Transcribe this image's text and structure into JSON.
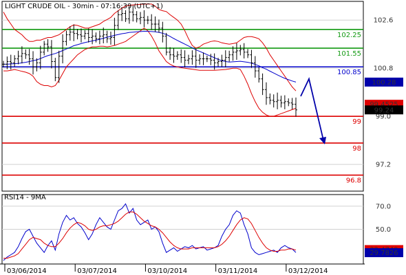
{
  "chart_data": [
    {
      "type": "candlestick",
      "title": "LIGHT CRUDE OIL - 30min - 07:16:39 (UTC+1)",
      "ylim": [
        96.2,
        103.3
      ],
      "y_ticks": [
        "102.6",
        "100.8",
        "99.0",
        "97.2"
      ],
      "x_ticks": [
        "03/06/2014",
        "03/07/2014",
        "03/10/2014",
        "03/11/2014",
        "03/12/2014"
      ],
      "levels": [
        {
          "label": "102.25",
          "value": 102.25,
          "color": "#119911"
        },
        {
          "label": "101.55",
          "value": 101.55,
          "color": "#119911"
        },
        {
          "label": "100.85",
          "value": 100.85,
          "color": "#0000cc"
        },
        {
          "label": "99",
          "value": 99.0,
          "color": "#dd0000"
        },
        {
          "label": "98",
          "value": 98.0,
          "color": "#dd0000"
        },
        {
          "label": "96.8",
          "value": 96.8,
          "color": "#dd0000"
        }
      ],
      "markers": [
        {
          "label": "100.28",
          "value": 100.28,
          "style": "blue-box"
        },
        {
          "label": "99.4525",
          "value": 99.45,
          "style": "red-box"
        },
        {
          "label": "99.24",
          "value": 99.24,
          "style": "black-box"
        }
      ],
      "price_series": [
        100.95,
        101.05,
        101.0,
        101.15,
        101.25,
        101.35,
        101.3,
        101.15,
        100.85,
        101.0,
        101.4,
        101.7,
        101.6,
        101.05,
        100.45,
        101.25,
        101.8,
        102.05,
        102.15,
        102.1,
        102.05,
        102.0,
        102.1,
        101.95,
        102.0,
        101.9,
        102.0,
        102.05,
        101.9,
        101.95,
        102.4,
        102.8,
        102.85,
        102.65,
        102.9,
        102.8,
        102.65,
        102.7,
        102.6,
        102.6,
        102.45,
        102.45,
        102.3,
        102.0,
        101.4,
        101.3,
        101.25,
        101.3,
        101.2,
        101.1,
        101.15,
        101.25,
        101.1,
        101.15,
        101.15,
        101.15,
        101.1,
        101.0,
        101.05,
        101.1,
        101.2,
        101.3,
        101.4,
        101.45,
        101.5,
        101.4,
        101.3,
        101.0,
        100.7,
        100.4,
        100.0,
        99.7,
        99.6,
        99.55,
        99.6,
        99.5,
        99.55,
        99.5,
        99.45,
        99.24
      ],
      "series": [
        {
          "name": "",
          "role": "moving-average",
          "color": "#0000cc",
          "values": [
            100.95,
            100.95,
            100.96,
            100.97,
            100.98,
            101.0,
            101.02,
            101.05,
            101.08,
            101.11,
            101.16,
            101.22,
            101.27,
            101.31,
            101.35,
            101.4,
            101.46,
            101.52,
            101.58,
            101.64,
            101.68,
            101.72,
            101.76,
            101.79,
            101.82,
            101.85,
            101.88,
            101.92,
            101.96,
            101.99,
            102.03,
            102.06,
            102.09,
            102.11,
            102.14,
            102.15,
            102.16,
            102.17,
            102.18,
            102.18,
            102.17,
            102.16,
            102.14,
            102.11,
            102.06,
            101.99,
            101.91,
            101.84,
            101.77,
            101.7,
            101.63,
            101.56,
            101.49,
            101.43,
            101.37,
            101.31,
            101.25,
            101.19,
            101.13,
            101.08,
            101.05,
            101.03,
            101.04,
            101.05,
            101.06,
            101.04,
            101.02,
            100.99,
            100.94,
            100.89,
            100.82,
            100.76,
            100.69,
            100.62,
            100.55,
            100.48,
            100.42,
            100.37,
            100.32,
            100.28
          ]
        },
        {
          "name": "",
          "role": "bollinger-upper",
          "color": "#dd0000",
          "values": [
            102.9,
            102.65,
            102.45,
            102.25,
            102.15,
            102.05,
            101.9,
            101.8,
            101.8,
            101.85,
            101.85,
            101.9,
            101.95,
            101.95,
            102.0,
            102.05,
            102.15,
            102.25,
            102.35,
            102.42,
            102.4,
            102.35,
            102.3,
            102.3,
            102.35,
            102.4,
            102.45,
            102.55,
            102.62,
            102.7,
            102.85,
            102.95,
            103.05,
            103.12,
            103.15,
            103.17,
            103.18,
            103.19,
            103.2,
            103.2,
            103.2,
            103.12,
            103.0,
            102.95,
            102.92,
            102.8,
            102.7,
            102.6,
            102.45,
            102.2,
            101.9,
            101.65,
            101.55,
            101.6,
            101.7,
            101.75,
            101.8,
            101.82,
            101.8,
            101.75,
            101.72,
            101.7,
            101.72,
            101.75,
            101.85,
            101.95,
            101.98,
            101.98,
            101.95,
            101.9,
            101.75,
            101.55,
            101.3,
            101.1,
            100.9,
            100.7,
            100.5,
            100.3,
            100.1,
            99.95
          ]
        },
        {
          "name": "",
          "role": "bollinger-lower",
          "color": "#dd0000",
          "values": [
            100.7,
            100.7,
            100.72,
            100.75,
            100.72,
            100.68,
            100.65,
            100.6,
            100.5,
            100.3,
            100.2,
            100.15,
            100.15,
            100.1,
            100.15,
            100.35,
            100.6,
            100.85,
            101.0,
            101.15,
            101.3,
            101.4,
            101.5,
            101.55,
            101.6,
            101.6,
            101.62,
            101.62,
            101.6,
            101.62,
            101.65,
            101.7,
            101.75,
            101.8,
            101.9,
            102.0,
            102.1,
            102.2,
            102.3,
            102.2,
            102.0,
            101.75,
            101.45,
            101.25,
            101.05,
            100.95,
            100.88,
            100.85,
            100.82,
            100.8,
            100.78,
            100.76,
            100.74,
            100.72,
            100.72,
            100.72,
            100.72,
            100.72,
            100.73,
            100.74,
            100.75,
            100.77,
            100.8,
            100.8,
            100.75,
            100.5,
            100.2,
            99.85,
            99.55,
            99.3,
            99.15,
            99.05,
            99.0,
            99.0,
            99.05,
            99.1,
            99.15,
            99.2,
            99.25,
            99.3
          ]
        }
      ],
      "forecast_arrow": {
        "from": 99.75,
        "via": 99.5,
        "to": 98.0
      }
    },
    {
      "type": "line",
      "title": "RSI14 - 9MA",
      "ylim": [
        20,
        80
      ],
      "y_ticks": [
        "70.0",
        "50.0"
      ],
      "markers": [
        {
          "label": "32.4749",
          "value": 32.47,
          "style": "red-box"
        },
        {
          "label": "29.7826",
          "value": 29.78,
          "style": "blue-box"
        }
      ],
      "series": [
        {
          "name": "",
          "role": "rsi",
          "color": "#0000cc",
          "values": [
            23,
            26,
            28,
            30,
            35,
            42,
            48,
            50,
            44,
            38,
            34,
            30,
            36,
            40,
            32,
            46,
            56,
            62,
            58,
            60,
            55,
            52,
            47,
            41,
            46,
            54,
            60,
            56,
            52,
            50,
            58,
            66,
            68,
            72,
            64,
            68,
            58,
            54,
            56,
            58,
            50,
            52,
            48,
            38,
            30,
            32,
            34,
            31,
            33,
            35,
            34,
            36,
            33,
            34,
            35,
            32,
            33,
            34,
            36,
            44,
            50,
            54,
            62,
            66,
            64,
            54,
            46,
            34,
            30,
            28,
            29,
            30,
            31,
            32,
            30,
            34,
            36,
            34,
            33,
            30
          ]
        },
        {
          "name": "",
          "role": "rsi-ma",
          "color": "#dd0000",
          "values": [
            25,
            25,
            26,
            27,
            29,
            33,
            37,
            41,
            43,
            42,
            41,
            38,
            36,
            35,
            35,
            38,
            42,
            47,
            51,
            54,
            56,
            55,
            53,
            50,
            49,
            50,
            52,
            53,
            53,
            54,
            55,
            57,
            60,
            63,
            65,
            65,
            63,
            60,
            57,
            55,
            53,
            52,
            50,
            47,
            43,
            39,
            36,
            34,
            33,
            33,
            33,
            34,
            34,
            34,
            34,
            34,
            34,
            34,
            35,
            37,
            40,
            44,
            49,
            54,
            58,
            60,
            59,
            55,
            49,
            43,
            38,
            34,
            32,
            31,
            31,
            32,
            32,
            33,
            33,
            32
          ]
        }
      ]
    }
  ]
}
